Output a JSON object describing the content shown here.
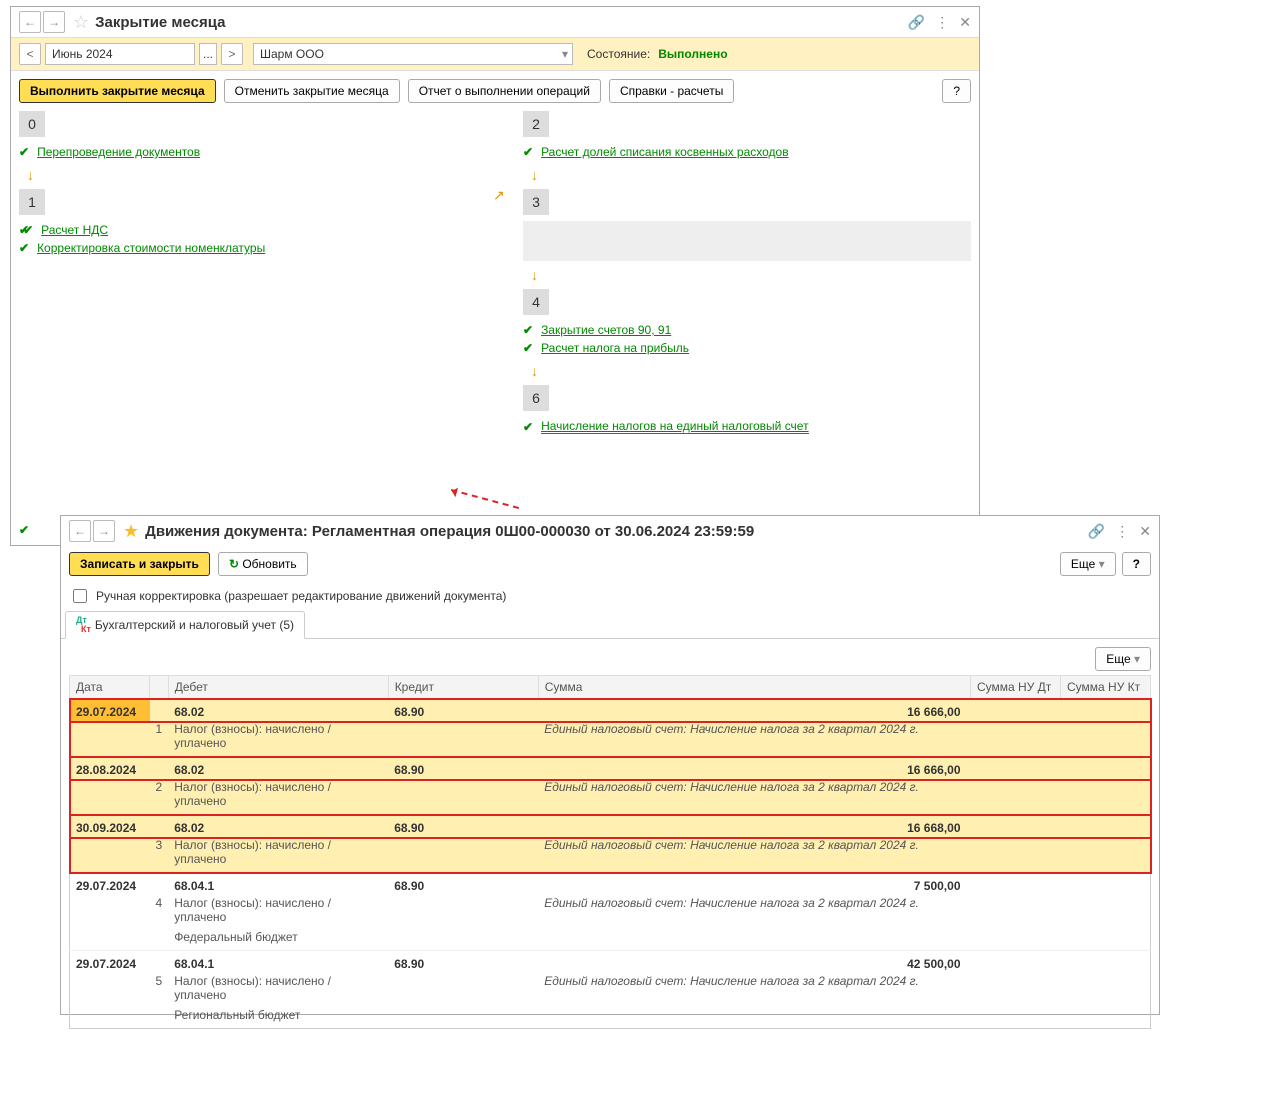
{
  "window1": {
    "title": "Закрытие месяца",
    "period": "Июнь 2024",
    "ellipsis": "...",
    "org": "Шарм ООО",
    "status_label": "Состояние:",
    "status_value": "Выполнено",
    "toolbar": {
      "btn_run": "Выполнить закрытие месяца",
      "btn_cancel": "Отменить закрытие месяца",
      "btn_report": "Отчет о выполнении операций",
      "btn_refs": "Справки - расчеты",
      "btn_help": "?"
    },
    "col_left": {
      "block0": {
        "num": "0",
        "items": [
          "Перепроведение документов"
        ]
      },
      "block1": {
        "num": "1",
        "items": [
          "Расчет НДС",
          "Корректировка стоимости номенклатуры"
        ]
      }
    },
    "col_right": {
      "block2": {
        "num": "2",
        "items": [
          "Расчет долей списания косвенных расходов"
        ]
      },
      "block3": {
        "num": "3"
      },
      "block4": {
        "num": "4",
        "items": [
          "Закрытие счетов 90, 91",
          "Расчет налога на прибыль"
        ]
      },
      "block6": {
        "num": "6",
        "items": [
          "Начисление налогов на единый налоговый счет"
        ]
      }
    }
  },
  "window2": {
    "title": "Движения документа: Регламентная операция 0Ш00-000030 от 30.06.2024 23:59:59",
    "toolbar": {
      "save": "Записать и закрыть",
      "refresh": "Обновить",
      "more": "Еще",
      "help": "?"
    },
    "manual_chk": "Ручная корректировка (разрешает редактирование движений документа)",
    "tab": "Бухгалтерский и налоговый учет (5)",
    "more2": "Еще",
    "headers": {
      "date": "Дата",
      "debit": "Дебет",
      "credit": "Кредит",
      "amount": "Сумма",
      "nu_dt": "Сумма НУ Дт",
      "nu_kt": "Сумма НУ Кт"
    },
    "rows": [
      {
        "hl": true,
        "date": "29.07.2024",
        "n": "1",
        "debit": "68.02",
        "credit": "68.90",
        "amount": "16 666,00",
        "sub_debit": "Налог (взносы): начислено / уплачено",
        "sub_credit": "Единый налоговый счет: Начисление налога за 2 квартал 2024 г.",
        "extra": ""
      },
      {
        "hl": true,
        "date": "28.08.2024",
        "n": "2",
        "debit": "68.02",
        "credit": "68.90",
        "amount": "16 666,00",
        "sub_debit": "Налог (взносы): начислено / уплачено",
        "sub_credit": "Единый налоговый счет: Начисление налога за 2 квартал 2024 г.",
        "extra": ""
      },
      {
        "hl": true,
        "date": "30.09.2024",
        "n": "3",
        "debit": "68.02",
        "credit": "68.90",
        "amount": "16 668,00",
        "sub_debit": "Налог (взносы): начислено / уплачено",
        "sub_credit": "Единый налоговый счет: Начисление налога за 2 квартал 2024 г.",
        "extra": ""
      },
      {
        "hl": false,
        "date": "29.07.2024",
        "n": "4",
        "debit": "68.04.1",
        "credit": "68.90",
        "amount": "7 500,00",
        "sub_debit": "Налог (взносы): начислено / уплачено",
        "sub_credit": "Единый налоговый счет: Начисление налога за 2 квартал 2024 г.",
        "extra": "Федеральный бюджет"
      },
      {
        "hl": false,
        "date": "29.07.2024",
        "n": "5",
        "debit": "68.04.1",
        "credit": "68.90",
        "amount": "42 500,00",
        "sub_debit": "Налог (взносы): начислено / уплачено",
        "sub_credit": "Единый налоговый счет: Начисление налога за 2 квартал 2024 г.",
        "extra": "Региональный бюджет"
      }
    ]
  }
}
